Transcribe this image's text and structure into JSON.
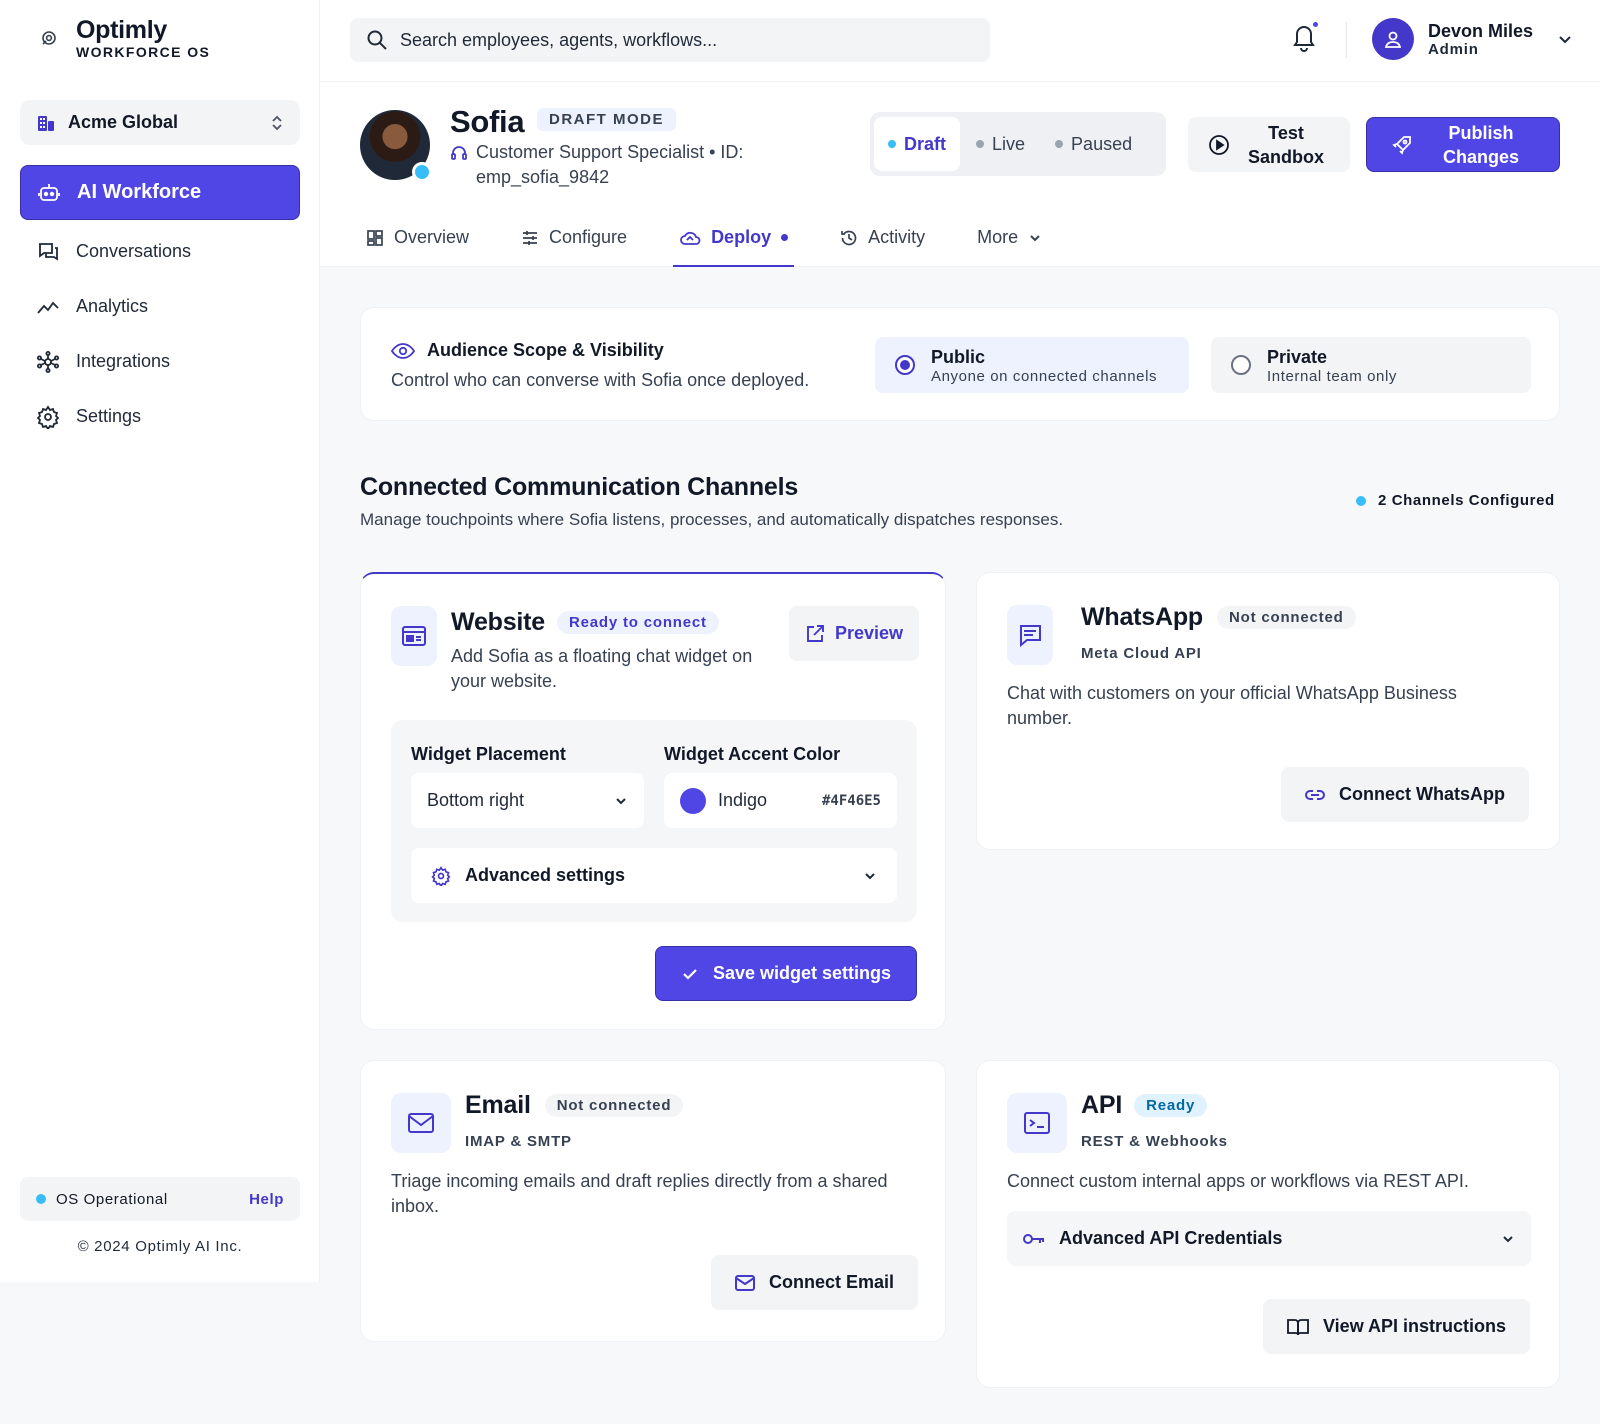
{
  "app": {
    "name": "Optimly",
    "subtitle": "WORKFORCE OS",
    "org": "Acme Global"
  },
  "sidebar": {
    "items": [
      {
        "label": "AI Workforce",
        "icon": "robot-icon",
        "active": true
      },
      {
        "label": "Conversations",
        "icon": "chat-bubbles-icon"
      },
      {
        "label": "Analytics",
        "icon": "trend-icon"
      },
      {
        "label": "Integrations",
        "icon": "network-icon"
      },
      {
        "label": "Settings",
        "icon": "gear-icon"
      }
    ],
    "status": "OS Operational",
    "help": "Help",
    "copyright": "© 2024 Optimly AI Inc."
  },
  "topbar": {
    "search_placeholder": "Search employees, agents, workflows...",
    "user_name": "Devon Miles",
    "user_role": "Admin"
  },
  "agent": {
    "name": "Sofia",
    "mode_badge": "DRAFT MODE",
    "role_line": "Customer Support Specialist • ID: emp_sofia_9842",
    "states": [
      "Draft",
      "Live",
      "Paused"
    ],
    "active_state": "Draft",
    "test_label": "Test Sandbox",
    "publish_label": "Publish Changes"
  },
  "tabs": [
    {
      "label": "Overview",
      "icon": "grid-icon"
    },
    {
      "label": "Configure",
      "icon": "sliders-icon"
    },
    {
      "label": "Deploy",
      "icon": "cloud-icon",
      "active": true
    },
    {
      "label": "Activity",
      "icon": "history-icon"
    },
    {
      "label": "More",
      "icon": "chevron-down-icon"
    }
  ],
  "scope": {
    "title": "Audience Scope & Visibility",
    "desc": "Control who can converse with Sofia once deployed.",
    "public_title": "Public",
    "public_sub": "Anyone on connected channels",
    "private_title": "Private",
    "private_sub": "Internal team only",
    "selected": "Public"
  },
  "channels": {
    "title": "Connected Communication Channels",
    "desc": "Manage touchpoints where Sofia listens, processes, and automatically dispatches responses.",
    "count": "2 Channels Configured",
    "website": {
      "name": "Website",
      "status": "Ready to connect",
      "desc": "Add Sofia as a floating chat widget on your website.",
      "preview": "Preview",
      "placement_label": "Widget Placement",
      "placement_value": "Bottom right",
      "color_label": "Widget Accent Color",
      "color_name": "Indigo",
      "color_hex": "#4F46E5",
      "advanced": "Advanced settings",
      "save": "Save widget settings"
    },
    "whatsapp": {
      "name": "WhatsApp",
      "status": "Not connected",
      "sub": "Meta Cloud API",
      "desc": "Chat with customers on your official WhatsApp Business number.",
      "button": "Connect WhatsApp"
    },
    "email": {
      "name": "Email",
      "status": "Not connected",
      "sub": "IMAP & SMTP",
      "desc": "Triage incoming emails and draft replies directly from a shared inbox.",
      "button": "Connect Email"
    },
    "api": {
      "name": "API",
      "status": "Ready",
      "sub": "REST & Webhooks",
      "desc": "Connect custom internal apps or workflows via REST API.",
      "advanced": "Advanced API Credentials",
      "button": "View API instructions"
    }
  },
  "colors": {
    "accent": "#4F46E5",
    "status": "#38BDF8"
  }
}
